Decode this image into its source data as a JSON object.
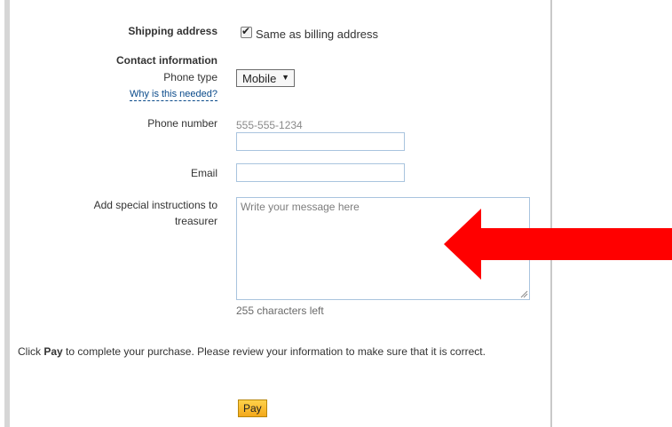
{
  "shipping": {
    "label": "Shipping address",
    "same_as_billing_label": "Same as billing address",
    "same_as_billing_checked": true
  },
  "contact": {
    "heading": "Contact information",
    "phone_type_label": "Phone type",
    "phone_type_value": "Mobile",
    "why_link": "Why is this needed?",
    "phone_number_label": "Phone number",
    "phone_number_hint": "555-555-1234",
    "phone_number_value": "",
    "email_label": "Email",
    "email_value": ""
  },
  "instructions": {
    "label_line1": "Add special instructions to",
    "label_line2": "treasurer",
    "placeholder": "Write your message here",
    "chars_left": "255 characters left"
  },
  "review": {
    "prefix": "Click",
    "bold_word": "Pay",
    "suffix": "to complete your purchase. Please review your information to make sure that it is correct."
  },
  "pay_button": "Pay",
  "annotation": {
    "arrow_color": "#ff0000"
  },
  "colors": {
    "link": "#0a4a8a",
    "button_top": "#ffd24a",
    "button_bottom": "#f3a81a",
    "input_border": "#a9c4de"
  }
}
